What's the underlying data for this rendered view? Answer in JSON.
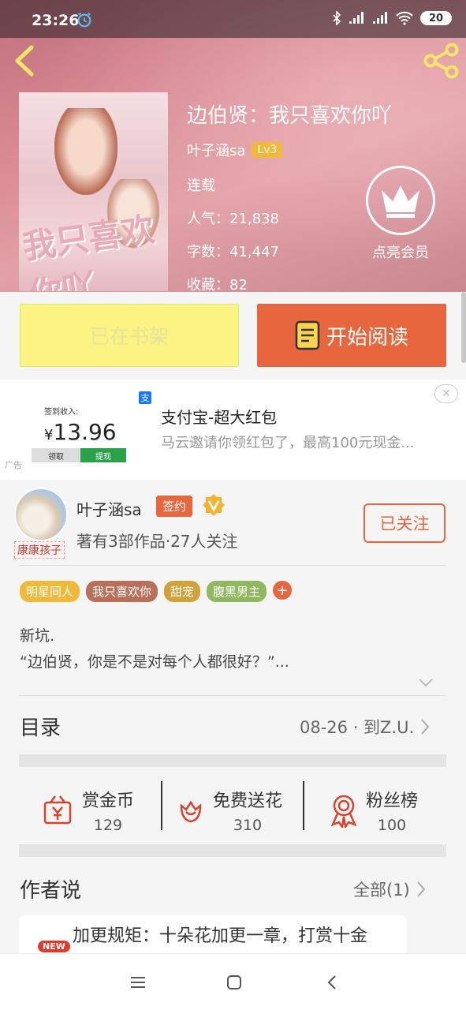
{
  "status": {
    "time": "23:26",
    "battery": "20"
  },
  "book": {
    "title": "边伯贤：我只喜欢你吖",
    "author": "叶子涵sa",
    "level": "Lv3",
    "status": "连载",
    "popularity_label": "人气：",
    "popularity": "21,838",
    "words_label": "字数：",
    "words": "41,447",
    "favorites_label": "收藏：",
    "favorites": "82",
    "cover_text": "我只喜欢你吖"
  },
  "vip": {
    "label": "点亮会员"
  },
  "actions": {
    "shelf": "已在书架",
    "read": "开始阅读"
  },
  "ad": {
    "sign_label": "签到收入:",
    "amount_symbol": "¥",
    "amount": "13.96",
    "btn_receive": "领取",
    "btn_withdraw": "提现",
    "ad_tag": "广告",
    "title": "支付宝-超大红包",
    "subtitle": "马云邀请你领红包了，最高100元现金..."
  },
  "author": {
    "name": "叶子涵sa",
    "sign": "签约",
    "avatar_tag": "康康孩子",
    "meta": "著有3部作品·27人关注",
    "follow": "已关注"
  },
  "tags": [
    {
      "label": "明星同人",
      "color": "#f0b93a"
    },
    {
      "label": "我只喜欢你",
      "color": "#b9705a"
    },
    {
      "label": "甜宠",
      "color": "#cfa33a"
    },
    {
      "label": "腹黑男主",
      "color": "#8fb860"
    }
  ],
  "description": {
    "line1": "新坑.",
    "line2": "“边伯贤，你是不是对每个人都很好？”..."
  },
  "toc": {
    "title": "目录",
    "latest": "08-26 · 到Z.U."
  },
  "stats": [
    {
      "label": "赏金币",
      "value": "129",
      "icon": "coin-bag-icon"
    },
    {
      "label": "免费送花",
      "value": "310",
      "icon": "flower-icon"
    },
    {
      "label": "粉丝榜",
      "value": "100",
      "icon": "medal-icon"
    }
  ],
  "author_notes": {
    "title": "作者说",
    "all": "全部(1)",
    "badge": "NEW",
    "note": "加更规矩：十朵花加更一章，打赏十金"
  },
  "colors": {
    "accent": "#e8663d",
    "shelf_bg": "#fbf483"
  }
}
